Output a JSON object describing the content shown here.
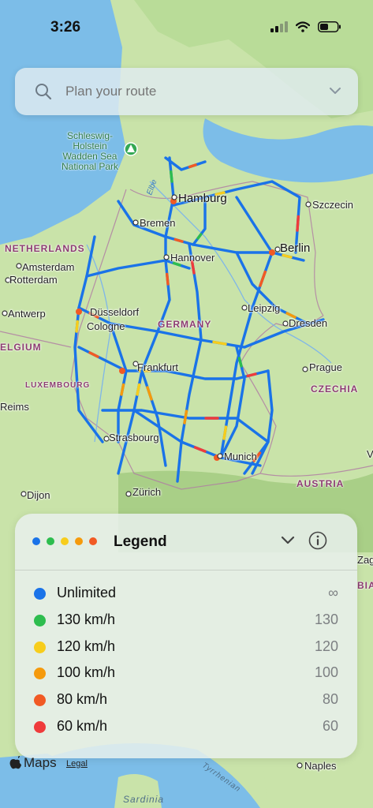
{
  "status_bar": {
    "time": "3:26"
  },
  "search": {
    "placeholder": "Plan your route"
  },
  "map_labels": {
    "schleswig": "Schleswig-",
    "holstein": "Holstein",
    "wadden": "Wadden Sea",
    "national_park": "National Park",
    "hamburg": "Hamburg",
    "bremen": "Bremen",
    "szczecin": "Szczecin",
    "berlin": "Berlin",
    "netherlands": "NETHERLANDS",
    "amsterdam": "Amsterdam",
    "rotterdam": "Rotterdam",
    "hannover": "Hannover",
    "antwerp": "Antwerp",
    "dusseldorf": "Düsseldorf",
    "cologne": "Cologne",
    "germany": "GERMANY",
    "leipzig": "Leipzig",
    "dresden": "Dresden",
    "belgium": "ELGIUM",
    "frankfurt": "Frankfurt",
    "prague": "Prague",
    "luxembourg": "LUXEMBOURG",
    "czechia": "CZECHIA",
    "reims": "Reims",
    "strasbourg": "Strasbourg",
    "munich": "Munich",
    "austria": "AUSTRIA",
    "dijon": "Dijon",
    "zurich": "Zürich",
    "elbe": "Elbe",
    "sardinia": "Sardinia",
    "naples": "Naples",
    "tyrrhenian": "Tyrrhenian",
    "zag": "Zag",
    "bia": "BIA",
    "edge_v": "V"
  },
  "legend": {
    "title": "Legend",
    "dot_colors": [
      "#1a73e8",
      "#2dbd4e",
      "#f7cd1c",
      "#f59a0c",
      "#f15a24"
    ],
    "items": [
      {
        "name": "Unlimited",
        "value": "∞",
        "color": "#1a73e8"
      },
      {
        "name": "130 km/h",
        "value": "130",
        "color": "#2dbd4e"
      },
      {
        "name": "120 km/h",
        "value": "120",
        "color": "#f7cd1c"
      },
      {
        "name": "100 km/h",
        "value": "100",
        "color": "#f59a0c"
      },
      {
        "name": "80 km/h",
        "value": "80",
        "color": "#f15a24"
      },
      {
        "name": "60 km/h",
        "value": "60",
        "color": "#ef3b3b"
      }
    ]
  },
  "footer": {
    "brand": "Maps",
    "legal": "Legal"
  }
}
